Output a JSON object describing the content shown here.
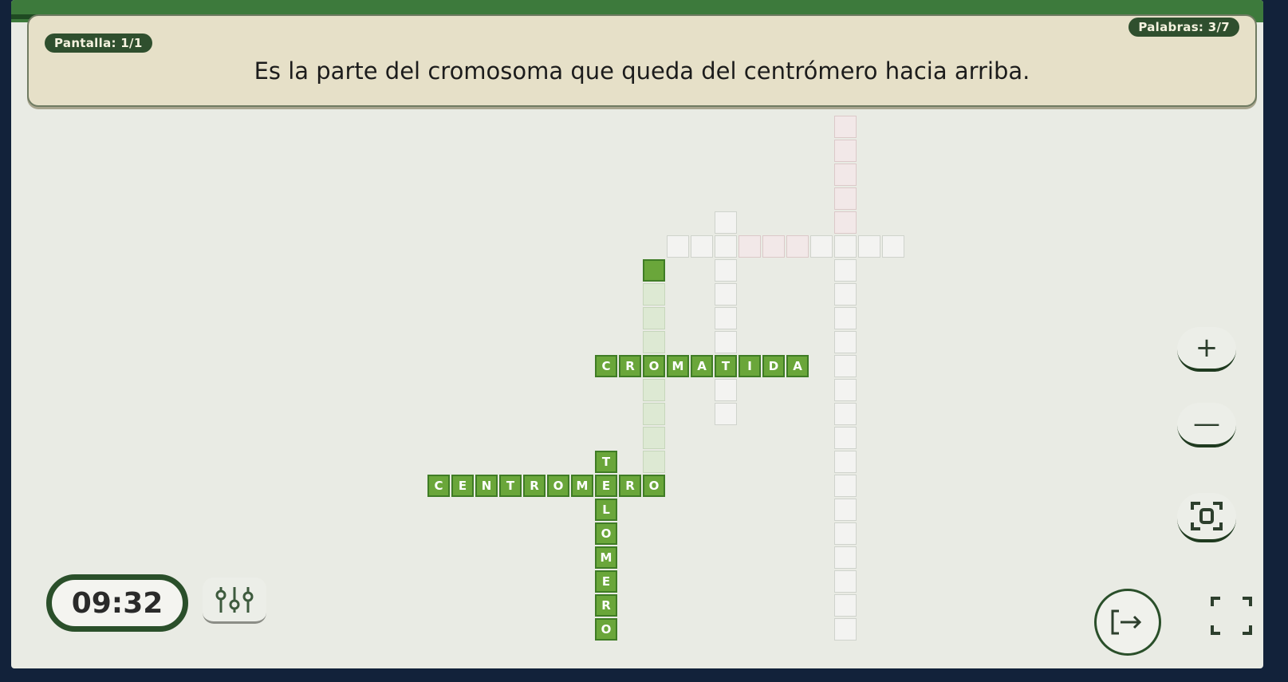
{
  "header": {
    "screen_counter": "Pantalla: 1/1",
    "words_counter": "Palabras: 3/7",
    "question": "Es la parte del cromosoma que queda del centrómero hacia arriba."
  },
  "crossword": {
    "words": [
      {
        "id": "cromatida",
        "letters": [
          "C",
          "R",
          "O",
          "M",
          "A",
          "T",
          "I",
          "D",
          "A"
        ]
      },
      {
        "id": "centromero",
        "letters": [
          "C",
          "E",
          "N",
          "T",
          "R",
          "O",
          "M",
          "E",
          "R",
          "O"
        ]
      },
      {
        "id": "telomero",
        "letters": [
          "T",
          "E",
          "L",
          "O",
          "M",
          "E",
          "R",
          "O"
        ]
      }
    ]
  },
  "controls": {
    "zoom_in": "+",
    "zoom_out": "—",
    "timer": "09:32"
  },
  "icons": {
    "zoom_in": "plus-icon",
    "zoom_out": "minus-icon",
    "center": "recenter-icon",
    "settings": "sliders-icon",
    "exit": "exit-icon",
    "fullscreen": "fullscreen-icon"
  },
  "colors": {
    "filled_cell": "#6aa63a",
    "accent_dark": "#2f4f2e",
    "header_bg": "#e6e0c8"
  }
}
